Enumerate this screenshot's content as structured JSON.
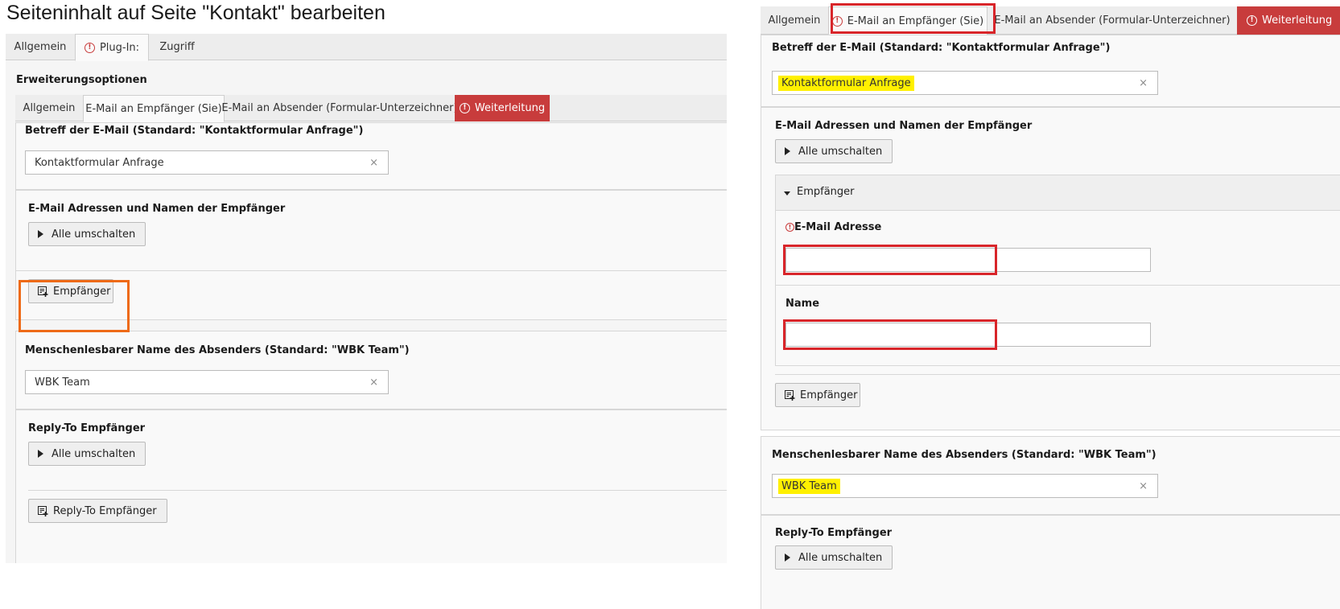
{
  "page_title": "Seiteninhalt auf Seite \"Kontakt\" bearbeiten",
  "left": {
    "main_tabs": [
      "Allgemein",
      "Plug-In:",
      "Zugriff"
    ],
    "section_title": "Erweiterungsoptionen",
    "sub_tabs": [
      "Allgemein",
      "E-Mail an Empfänger (Sie)",
      "E-Mail an Absender (Formular-Unterzeichner)",
      "Weiterleitung"
    ],
    "subject_label": "Betreff der E-Mail (Standard: \"Kontaktformular Anfrage\")",
    "subject_value": "Kontaktformular Anfrage",
    "recipients_label": "E-Mail Adressen und Namen der Empfänger",
    "toggle_all": "Alle umschalten",
    "add_recipient": "Empfänger",
    "sender_name_label": "Menschenlesbarer Name des Absenders (Standard: \"WBK Team\")",
    "sender_name_value": "WBK Team",
    "reply_to_label": "Reply-To Empfänger",
    "reply_toggle_all": "Alle umschalten",
    "add_reply_to": "Reply-To Empfänger"
  },
  "right": {
    "tabs": [
      "Allgemein",
      "E-Mail an Empfänger (Sie)",
      "E-Mail an Absender (Formular-Unterzeichner)",
      "Weiterleitung"
    ],
    "subject_label": "Betreff der E-Mail (Standard: \"Kontaktformular Anfrage\")",
    "subject_value": "Kontaktformular Anfrage",
    "recipients_label": "E-Mail Adressen und Namen der Empfänger",
    "toggle_all": "Alle umschalten",
    "recipient_item_title": "Empfänger",
    "email_label": "E-Mail Adresse",
    "email_value": "",
    "name_label": "Name",
    "name_value": "",
    "add_recipient": "Empfänger",
    "sender_name_label": "Menschenlesbarer Name des Absenders (Standard: \"WBK Team\")",
    "sender_name_value": "WBK Team",
    "reply_to_label": "Reply-To Empfänger",
    "reply_toggle_all": "Alle umschalten"
  },
  "icons": {
    "clear": "×",
    "warning": "!"
  },
  "colors": {
    "error_tab": "#c83c3c",
    "highlight_orange": "#ee6a17",
    "highlight_red": "#d8252a",
    "text_highlight": "#fff000"
  }
}
